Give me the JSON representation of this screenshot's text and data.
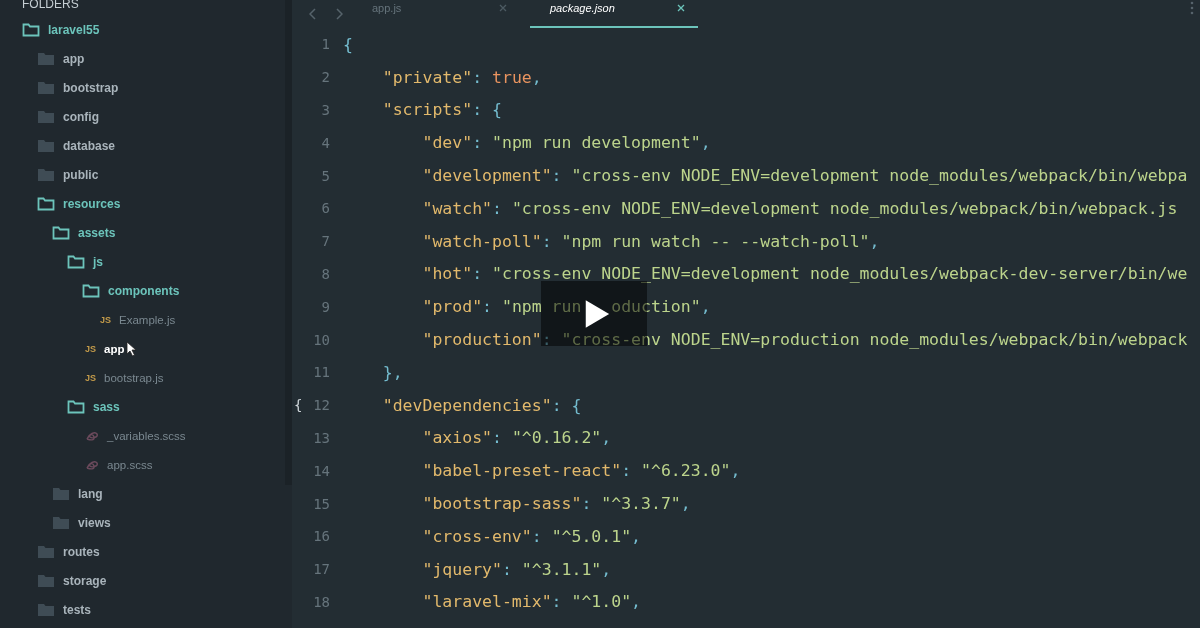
{
  "sidebar": {
    "header": "FOLDERS",
    "tree": [
      {
        "name": "laravel55",
        "kind": "folder",
        "expanded": true,
        "selected": false,
        "children": [
          {
            "name": "app",
            "kind": "folder",
            "expanded": false,
            "selected": false
          },
          {
            "name": "bootstrap",
            "kind": "folder",
            "expanded": false,
            "selected": false
          },
          {
            "name": "config",
            "kind": "folder",
            "expanded": false,
            "selected": false
          },
          {
            "name": "database",
            "kind": "folder",
            "expanded": false,
            "selected": false
          },
          {
            "name": "public",
            "kind": "folder",
            "expanded": false,
            "selected": false
          },
          {
            "name": "resources",
            "kind": "folder",
            "expanded": true,
            "selected": false,
            "children": [
              {
                "name": "assets",
                "kind": "folder",
                "expanded": true,
                "selected": false,
                "children": [
                  {
                    "name": "js",
                    "kind": "folder",
                    "expanded": true,
                    "selected": false,
                    "children": [
                      {
                        "name": "components",
                        "kind": "folder",
                        "expanded": true,
                        "selected": false,
                        "children": [
                          {
                            "name": "Example.js",
                            "kind": "js",
                            "badge": "JS",
                            "selected": false
                          }
                        ]
                      },
                      {
                        "name": "app",
                        "kind": "js",
                        "badge": "JS",
                        "selected": true
                      },
                      {
                        "name": "bootstrap.js",
                        "kind": "js",
                        "badge": "JS",
                        "selected": false
                      }
                    ]
                  },
                  {
                    "name": "sass",
                    "kind": "folder",
                    "expanded": true,
                    "selected": false,
                    "children": [
                      {
                        "name": "_variables.scss",
                        "kind": "scss",
                        "selected": false
                      },
                      {
                        "name": "app.scss",
                        "kind": "scss",
                        "selected": false
                      }
                    ]
                  }
                ]
              },
              {
                "name": "lang",
                "kind": "folder",
                "expanded": false,
                "selected": false
              },
              {
                "name": "views",
                "kind": "folder",
                "expanded": false,
                "selected": false
              }
            ]
          },
          {
            "name": "routes",
            "kind": "folder",
            "expanded": false,
            "selected": false
          },
          {
            "name": "storage",
            "kind": "folder",
            "expanded": false,
            "selected": false
          },
          {
            "name": "tests",
            "kind": "folder",
            "expanded": false,
            "selected": false
          }
        ]
      }
    ]
  },
  "tabs": [
    {
      "label": "app.js",
      "selected": false
    },
    {
      "label": "package.json",
      "selected": true
    }
  ],
  "editor": {
    "lines": [
      {
        "number": "1",
        "tokens": [
          {
            "kind": "punct",
            "text": "{"
          }
        ],
        "children": [
          {
            "number": "2",
            "tokens": [
              {
                "kind": "key",
                "text": "\"private\""
              },
              {
                "kind": "punct",
                "text": ": "
              },
              {
                "kind": "bool",
                "text": "true"
              },
              {
                "kind": "punct",
                "text": ","
              }
            ]
          },
          {
            "number": "3",
            "tokens": [
              {
                "kind": "key",
                "text": "\"scripts\""
              },
              {
                "kind": "punct",
                "text": ": {"
              }
            ],
            "children": [
              {
                "number": "4",
                "tokens": [
                  {
                    "kind": "key",
                    "text": "\"dev\""
                  },
                  {
                    "kind": "punct",
                    "text": ": "
                  },
                  {
                    "kind": "string",
                    "text": "\"npm run development\""
                  },
                  {
                    "kind": "punct",
                    "text": ","
                  }
                ]
              },
              {
                "number": "5",
                "tokens": [
                  {
                    "kind": "key",
                    "text": "\"development\""
                  },
                  {
                    "kind": "punct",
                    "text": ": "
                  },
                  {
                    "kind": "string",
                    "text": "\"cross-env NODE_ENV=development node_modules/webpack/bin/webpa"
                  }
                ]
              },
              {
                "number": "6",
                "tokens": [
                  {
                    "kind": "key",
                    "text": "\"watch\""
                  },
                  {
                    "kind": "punct",
                    "text": ": "
                  },
                  {
                    "kind": "string",
                    "text": "\"cross-env NODE_ENV=development node_modules/webpack/bin/webpack.js"
                  }
                ]
              },
              {
                "number": "7",
                "tokens": [
                  {
                    "kind": "key",
                    "text": "\"watch-poll\""
                  },
                  {
                    "kind": "punct",
                    "text": ": "
                  },
                  {
                    "kind": "string",
                    "text": "\"npm run watch -- --watch-poll\""
                  },
                  {
                    "kind": "punct",
                    "text": ","
                  }
                ]
              },
              {
                "number": "8",
                "tokens": [
                  {
                    "kind": "key",
                    "text": "\"hot\""
                  },
                  {
                    "kind": "punct",
                    "text": ": "
                  },
                  {
                    "kind": "string",
                    "text": "\"cross-env NODE_ENV=development node_modules/webpack-dev-server/bin/we"
                  }
                ]
              },
              {
                "number": "9",
                "tokens": [
                  {
                    "kind": "key",
                    "text": "\"prod\""
                  },
                  {
                    "kind": "punct",
                    "text": ": "
                  },
                  {
                    "kind": "string",
                    "text": "\"npm run"
                  }
                ],
                "tokens_after_cover": [
                  {
                    "kind": "string",
                    "text": "oduction\""
                  },
                  {
                    "kind": "punct",
                    "text": ","
                  }
                ]
              },
              {
                "number": "10",
                "tokens": [
                  {
                    "kind": "key",
                    "text": "\"production\""
                  },
                  {
                    "kind": "punct",
                    "text": ": "
                  },
                  {
                    "kind": "string",
                    "text": "\"cross-env NODE_ENV=production node_modules/webpack/bin/webpack"
                  }
                ]
              }
            ]
          },
          {
            "number": "11",
            "tokens": [
              {
                "kind": "punct",
                "text": "},"
              }
            ]
          },
          {
            "number": "12",
            "fold_marker": "{",
            "tokens": [
              {
                "kind": "key",
                "text": "\"devDependencies\""
              },
              {
                "kind": "punct",
                "text": ": {"
              }
            ],
            "children": [
              {
                "number": "13",
                "tokens": [
                  {
                    "kind": "key",
                    "text": "\"axios\""
                  },
                  {
                    "kind": "punct",
                    "text": ": "
                  },
                  {
                    "kind": "string",
                    "text": "\"^0.16.2\""
                  },
                  {
                    "kind": "punct",
                    "text": ","
                  }
                ]
              },
              {
                "number": "14",
                "tokens": [
                  {
                    "kind": "key",
                    "text": "\"babel-preset-react\""
                  },
                  {
                    "kind": "punct",
                    "text": ": "
                  },
                  {
                    "kind": "string",
                    "text": "\"^6.23.0\""
                  },
                  {
                    "kind": "punct",
                    "text": ","
                  }
                ]
              },
              {
                "number": "15",
                "tokens": [
                  {
                    "kind": "key",
                    "text": "\"bootstrap-sass\""
                  },
                  {
                    "kind": "punct",
                    "text": ": "
                  },
                  {
                    "kind": "string",
                    "text": "\"^3.3.7\""
                  },
                  {
                    "kind": "punct",
                    "text": ","
                  }
                ]
              },
              {
                "number": "16",
                "tokens": [
                  {
                    "kind": "key",
                    "text": "\"cross-env\""
                  },
                  {
                    "kind": "punct",
                    "text": ": "
                  },
                  {
                    "kind": "string",
                    "text": "\"^5.0.1\""
                  },
                  {
                    "kind": "punct",
                    "text": ","
                  }
                ]
              },
              {
                "number": "17",
                "tokens": [
                  {
                    "kind": "key",
                    "text": "\"jquery\""
                  },
                  {
                    "kind": "punct",
                    "text": ": "
                  },
                  {
                    "kind": "string",
                    "text": "\"^3.1.1\""
                  },
                  {
                    "kind": "punct",
                    "text": ","
                  }
                ]
              },
              {
                "number": "18",
                "tokens": [
                  {
                    "kind": "key",
                    "text": "\"laravel-mix\""
                  },
                  {
                    "kind": "punct",
                    "text": ": "
                  },
                  {
                    "kind": "string",
                    "text": "\"^1.0\""
                  },
                  {
                    "kind": "punct",
                    "text": ","
                  }
                ]
              }
            ]
          }
        ]
      }
    ]
  }
}
